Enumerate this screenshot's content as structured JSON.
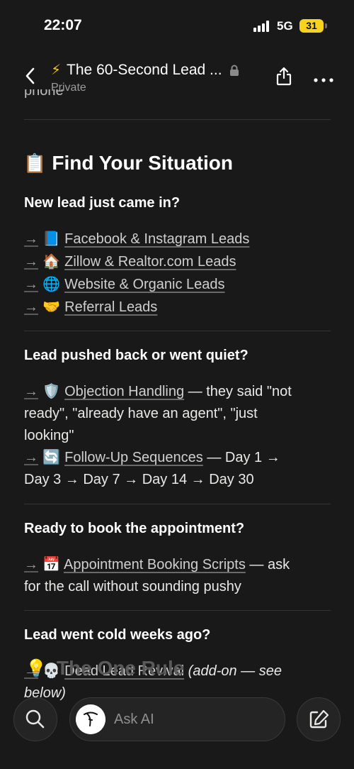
{
  "status": {
    "time": "22:07",
    "network": "5G",
    "battery": "31"
  },
  "header": {
    "title_emoji": "⚡",
    "title": "The 60-Second Lead ...",
    "privacy": "Private"
  },
  "content": {
    "clipped_text": "phone",
    "section_emoji": "📋",
    "section_title": "Find Your Situation",
    "q1": "New lead just came in?",
    "arrow": "→",
    "links1": [
      {
        "emoji": "📘",
        "label": "Facebook & Instagram Leads"
      },
      {
        "emoji": "🏠",
        "label": "Zillow & Realtor.com Leads"
      },
      {
        "emoji": "🌐",
        "label": "Website & Organic Leads"
      },
      {
        "emoji": "🤝",
        "label": "Referral Leads"
      }
    ],
    "q2": "Lead pushed back or went quiet?",
    "objection": {
      "emoji": "🛡️",
      "label": "Objection Handling",
      "desc_l1": " — they said \"not",
      "desc_l2": "ready\", \"already have an agent\", \"just",
      "desc_l3": "looking\""
    },
    "followup": {
      "emoji": "🔄",
      "label": "Follow-Up Sequences",
      "desc_l1": " — Day 1 →",
      "desc_l2": "Day 3 → Day 7 → Day 14 → Day 30"
    },
    "q3": "Ready to book the appointment?",
    "booking": {
      "emoji": "📅",
      "label": "Appointment Booking Scripts",
      "desc_l1": " — ask",
      "desc_l2": "for the call without sounding pushy"
    },
    "q4": "Lead went cold weeks ago?",
    "revival": {
      "emoji": "💀",
      "label": "Dead Lead Revival",
      "note_l1": " (add-on — see",
      "note_l2": "below)"
    },
    "next_emoji": "💡",
    "next_title": "The One Rule"
  },
  "bottom": {
    "ask_ai": "Ask AI"
  }
}
